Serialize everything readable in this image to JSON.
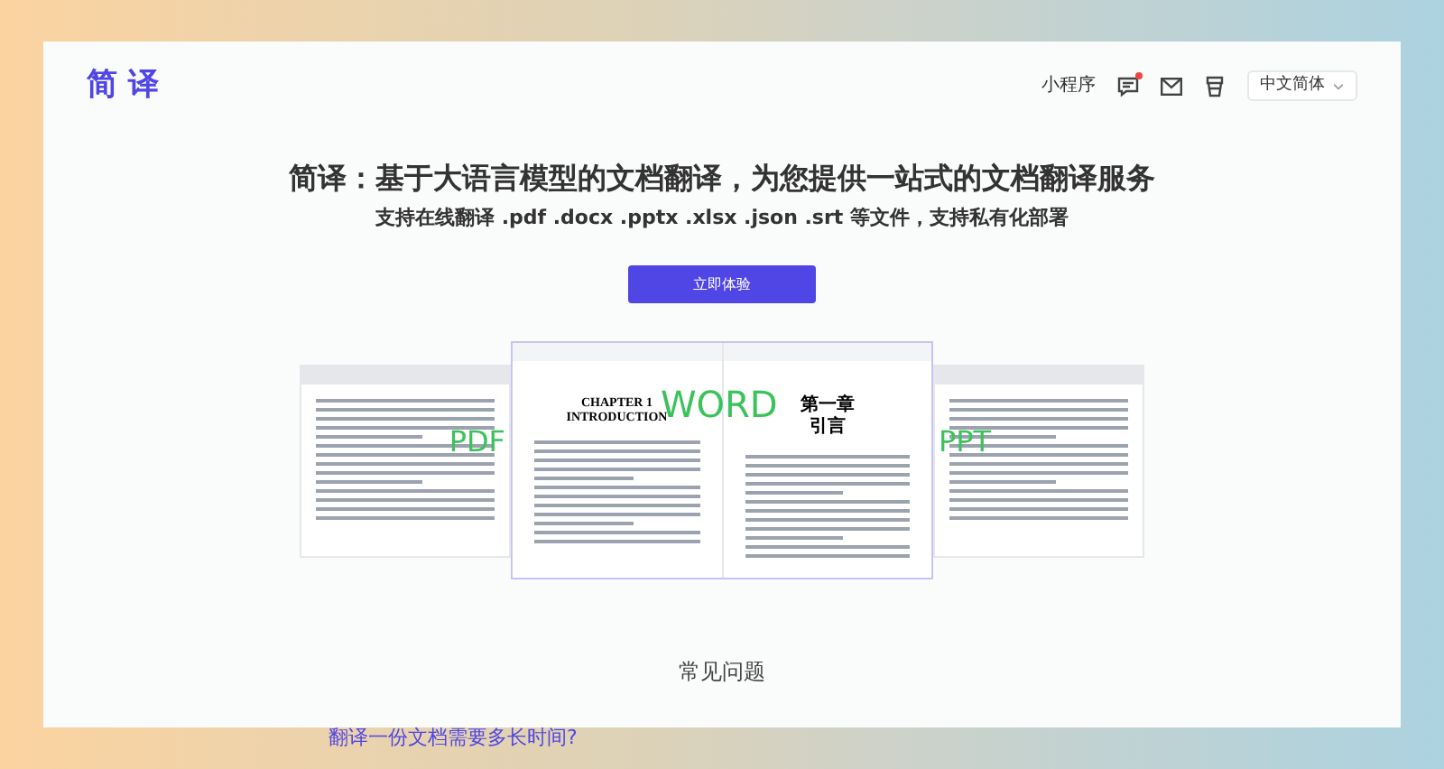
{
  "header": {
    "logo": "简 译",
    "tools_label": "小程序",
    "notification_dot": true,
    "language": "中文简体"
  },
  "hero": {
    "title": "简译：基于大语言模型的文档翻译，为您提供一站式的文档翻译服务",
    "subtitle": "支持在线翻译 .pdf .docx .pptx .xlsx .json .srt 等文件，支持私有化部署",
    "button": "立即体验"
  },
  "previews": [
    {
      "kind": "side",
      "label": "PDF"
    },
    {
      "kind": "main",
      "label": "WORD",
      "left_page": [
        "CHAPTER 1",
        "INTRODUCTION"
      ],
      "right_page": [
        "第一章",
        "引言"
      ]
    },
    {
      "kind": "side",
      "label": "PPT"
    }
  ],
  "faq": {
    "title": "常见问题",
    "items": [
      "翻译一份文档需要多长时间?"
    ]
  }
}
